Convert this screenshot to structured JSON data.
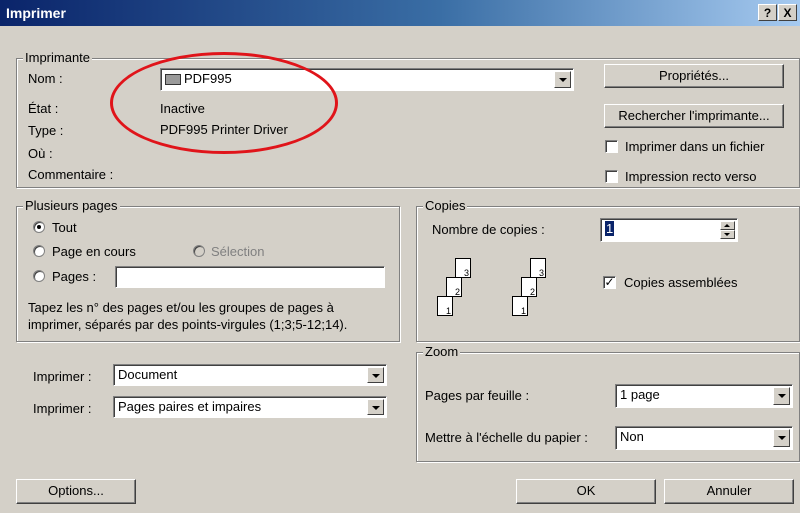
{
  "window": {
    "title": "Imprimer",
    "help_label": "?",
    "close_label": "X"
  },
  "printer": {
    "group_label": "Imprimante",
    "name_label": "Nom :",
    "name_value": "PDF995",
    "status_label": "État :",
    "status_value": "Inactive",
    "type_label": "Type :",
    "type_value": "PDF995 Printer Driver",
    "where_label": "Où :",
    "comment_label": "Commentaire :",
    "properties_button": "Propriétés...",
    "find_printer_button": "Rechercher l'imprimante...",
    "print_to_file_label": "Imprimer dans un fichier",
    "duplex_label": "Impression recto verso",
    "print_to_file_checked": false,
    "duplex_checked": false
  },
  "pages": {
    "group_label": "Plusieurs pages",
    "all_label": "Tout",
    "current_label": "Page en cours",
    "selection_label": "Sélection",
    "pages_label": "Pages :",
    "pages_value": "",
    "selected": "Tout",
    "help_line1": "Tapez les n° des pages et/ou les groupes de pages à",
    "help_line2": "imprimer, séparés par des points-virgules (1;3;5-12;14)."
  },
  "copies": {
    "group_label": "Copies",
    "count_label": "Nombre de copies :",
    "count_value": "1",
    "collate_label": "Copies assemblées",
    "collate_checked": true,
    "collate_mark": "✓",
    "stack_a": [
      "1",
      "2",
      "3"
    ],
    "stack_b": [
      "1",
      "2",
      "3"
    ]
  },
  "print_what": {
    "label1": "Imprimer :",
    "value1": "Document",
    "label2": "Imprimer :",
    "value2": "Pages paires et impaires"
  },
  "zoom": {
    "group_label": "Zoom",
    "pages_per_sheet_label": "Pages par feuille :",
    "pages_per_sheet_value": "1 page",
    "scale_label": "Mettre à l'échelle du papier :",
    "scale_value": "Non"
  },
  "footer": {
    "options_button": "Options...",
    "ok_button": "OK",
    "cancel_button": "Annuler"
  },
  "colors": {
    "annotation": "#e0141a",
    "titlebar": "#0a246a"
  }
}
